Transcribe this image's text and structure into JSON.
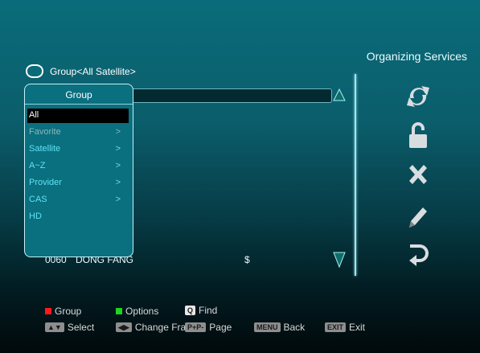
{
  "header": {
    "title": "Organizing Services",
    "group_label": "Group<All Satellite>"
  },
  "popup": {
    "title": "Group",
    "items": [
      {
        "label": "All",
        "chevron": "",
        "state": "selected"
      },
      {
        "label": "Favorite",
        "chevron": ">",
        "state": "dim"
      },
      {
        "label": "Satellite",
        "chevron": ">",
        "state": "normal"
      },
      {
        "label": "A~Z",
        "chevron": ">",
        "state": "normal"
      },
      {
        "label": "Provider",
        "chevron": ">",
        "state": "normal"
      },
      {
        "label": "CAS",
        "chevron": ">",
        "state": "normal"
      },
      {
        "label": "HD",
        "chevron": "",
        "state": "normal"
      }
    ]
  },
  "channel_row": {
    "number": "0060",
    "name": "DONG FANG",
    "flag": "$"
  },
  "side_icons": [
    "refresh-icon",
    "lock-icon",
    "delete-icon",
    "rename-icon",
    "move-icon"
  ],
  "footer": {
    "group": "Group",
    "options": "Options",
    "find": "Find",
    "select": "Select",
    "change_frame": "Change Fram",
    "page_key": "P+P-",
    "page": "Page",
    "menu_key": "MENU",
    "back": "Back",
    "exit_key": "EXIT",
    "exit": "Exit",
    "find_key": "Q"
  },
  "colors": {
    "red": "#ff1a1a",
    "green": "#1fd31f",
    "accent": "#5fe3f7"
  }
}
